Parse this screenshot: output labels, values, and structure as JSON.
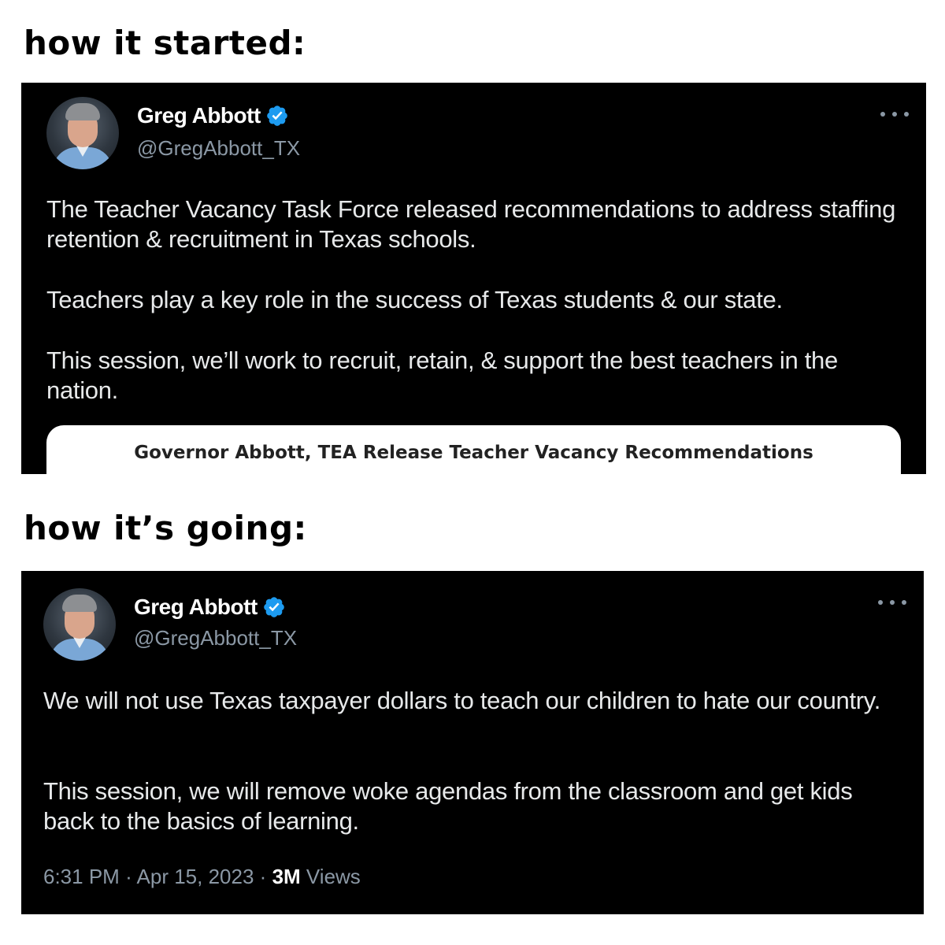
{
  "captions": {
    "top": "how it started:",
    "bottom": "how it’s going:"
  },
  "tweet1": {
    "display_name": "Greg Abbott",
    "handle": "@GregAbbott_TX",
    "paragraphs": [
      "The Teacher Vacancy Task Force released recommendations to address staffing retention & recruitment in Texas schools.",
      "Teachers play a key role in the success of Texas students & our state.",
      "This session, we’ll work to recruit, retain, & support the best teachers in the nation."
    ],
    "link_card_title": "Governor Abbott, TEA Release Teacher Vacancy Recommendations"
  },
  "tweet2": {
    "display_name": "Greg Abbott",
    "handle": "@GregAbbott_TX",
    "paragraphs": [
      "We will not use Texas taxpayer dollars to teach our children to hate our country.",
      "This session, we will remove woke agendas from the classroom and get kids back to the basics of learning."
    ],
    "time": "6:31 PM",
    "separator": "·",
    "date": "Apr 15, 2023",
    "views_count": "3M",
    "views_label": "Views"
  },
  "icons": {
    "verified": "verified-badge-icon",
    "more": "more-options-icon",
    "avatar": "profile-avatar"
  },
  "colors": {
    "tweet_background": "#000000",
    "primary_text": "#e7e9ea",
    "secondary_text": "#8b98a5",
    "verified_blue": "#1d9bf0"
  }
}
